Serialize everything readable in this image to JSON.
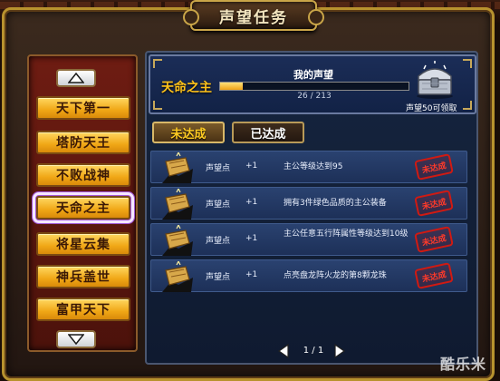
{
  "window": {
    "title": "声望任务"
  },
  "nav": {
    "items": [
      {
        "label": "天下第一"
      },
      {
        "label": "塔防天王"
      },
      {
        "label": "不败战神"
      },
      {
        "label": "天命之主"
      },
      {
        "label": "将星云集"
      },
      {
        "label": "神兵盖世"
      },
      {
        "label": "富甲天下"
      }
    ],
    "active_index": 3
  },
  "header": {
    "current_title": "天命之主",
    "reputation_label": "我的声望",
    "progress_text": "26 / 213",
    "progress_fraction": 0.122,
    "reward_caption": "声望50可领取"
  },
  "tabs": [
    {
      "label": "未达成",
      "selected": true
    },
    {
      "label": "已达成",
      "selected": false
    }
  ],
  "quests": [
    {
      "key": "声望点",
      "value": "+1",
      "desc": "主公等级达到95",
      "status": "未达成"
    },
    {
      "key": "声望点",
      "value": "+1",
      "desc": "拥有3件绿色品质的主公装备",
      "status": "未达成"
    },
    {
      "key": "声望点",
      "value": "+1",
      "desc": "主公任意五行阵属性等级达到10级",
      "status": "未达成"
    },
    {
      "key": "声望点",
      "value": "+1",
      "desc": "点亮盘龙阵火龙的第8颗龙珠",
      "status": "未达成"
    }
  ],
  "pagination": {
    "text": "1 / 1"
  },
  "watermark": "酷乐米",
  "colors": {
    "accent_gold": "#f0a716",
    "stamp_red": "#d01a12",
    "panel_blue": "#1b2d57"
  },
  "icons": {
    "chest": "silver-chest-icon",
    "quest": "gold-treasure-icon",
    "up": "arrow-up-icon",
    "down": "arrow-down-icon"
  }
}
